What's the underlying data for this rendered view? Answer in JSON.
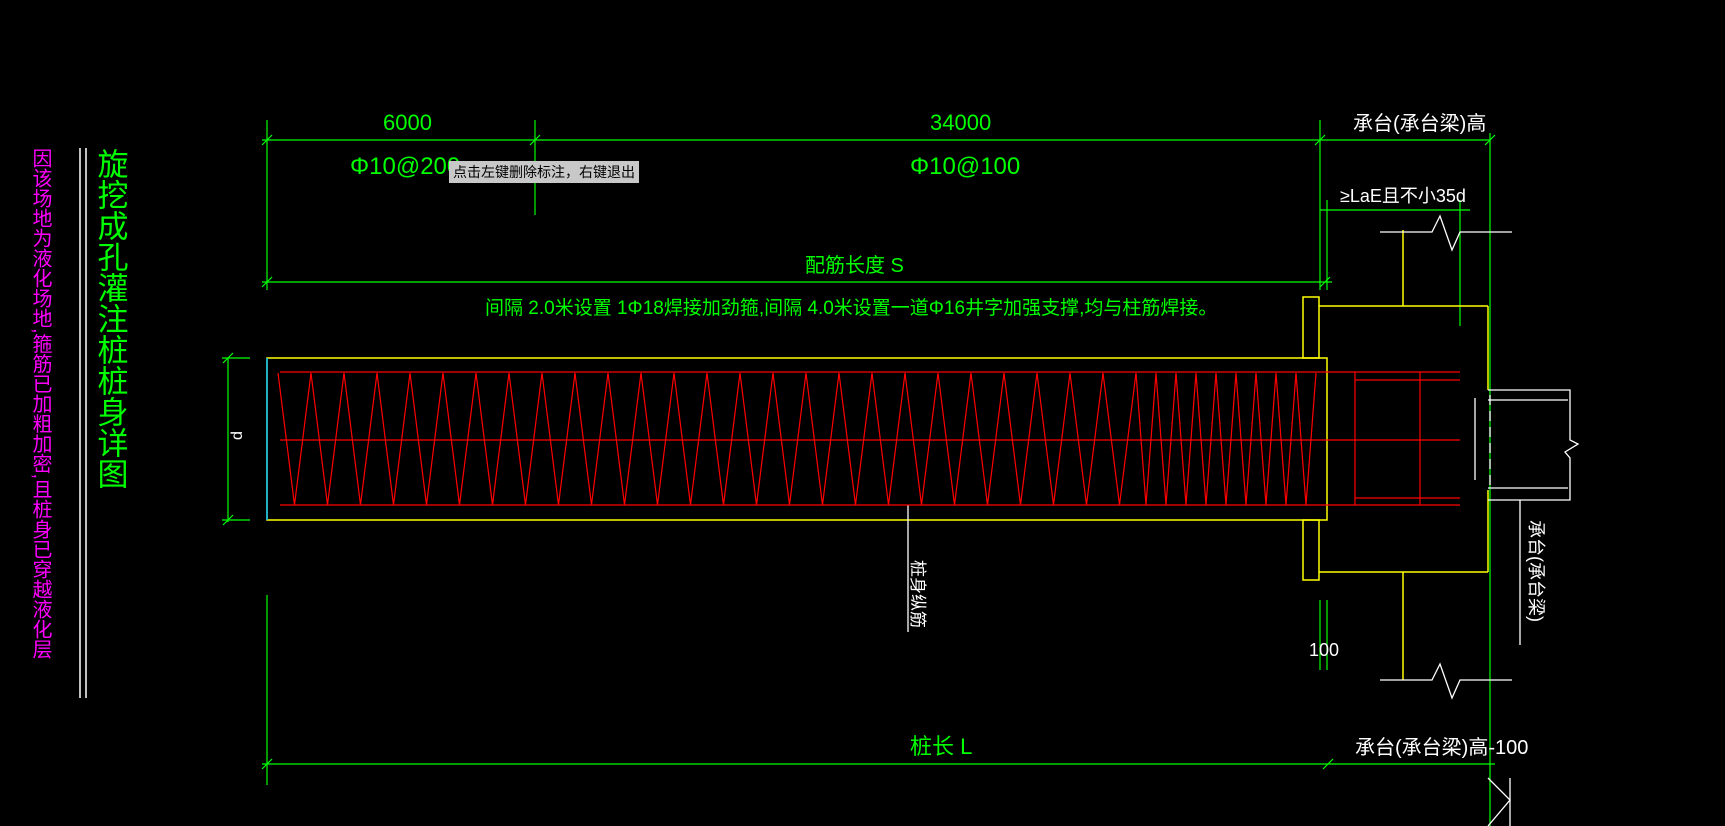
{
  "tooltip": "点击左键删除标注，右键退出",
  "labels": {
    "dim_6000": "6000",
    "dim_34000": "34000",
    "cap_height": "承台(承台梁)高",
    "rebar_dense": "Φ10@200",
    "rebar_sparse": "Φ10@100",
    "anchor": "≥LaE且不小35d",
    "rebar_length": "配筋长度 S",
    "note": "间隔 2.0米设置 1Φ18焊接加劲箍,间隔 4.0米设置一道Φ16井字加强支撑,均与柱筋焊接。",
    "d": "d",
    "longitudinal": "桩身纵筋",
    "cap_side": "承台(承台梁)",
    "dim_100": "100",
    "pile_length": "桩长 L",
    "cap_height_minus": "承台(承台梁)高-100",
    "title_vertical": "旋挖成孔灌注桩桩身详图",
    "note_vertical": "因该场地为液化场地,箍筋已加粗加密,且桩身已穿越液化层"
  },
  "colors": {
    "dimension": "#00ff00",
    "rebar": "#ff0000",
    "outline": "#ffff00",
    "text_white": "#ffffff",
    "text_magenta": "#ff00ff",
    "pile_edge": "#00bfff"
  }
}
